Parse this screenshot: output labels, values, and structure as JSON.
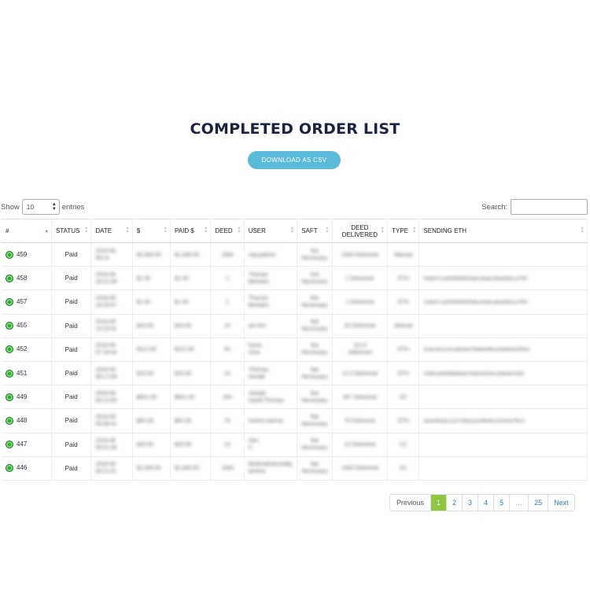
{
  "page": {
    "title": "COMPLETED ORDER LIST",
    "download_label": "DOWNLOAD AS CSV"
  },
  "length_control": {
    "prefix": "Show",
    "value": "10",
    "suffix": "entries"
  },
  "search": {
    "label": "Search:",
    "value": ""
  },
  "table": {
    "headers": [
      "#",
      "STATUS",
      "DATE",
      "$",
      "PAID $",
      "DEED",
      "USER",
      "SAFT",
      "DEED DELIVERED",
      "TYPE",
      "SENDING ETH"
    ],
    "rows": [
      {
        "id": "459",
        "status": "Paid",
        "date": "2018-06 06:14",
        "amount": "$1,000.00",
        "paid": "$1,000.00",
        "deed": "1000",
        "user": "clay.patrick",
        "saft": "Not Necessary",
        "delivered": "1000 Delivered",
        "type": "Manual",
        "eth": ""
      },
      {
        "id": "458",
        "status": "Paid",
        "date": "2018-06 16:21:08",
        "amount": "$1.00",
        "paid": "$1.00",
        "deed": "1",
        "user": "Thomas Bertulen",
        "saft": "Not Necessary",
        "delivered": "1 Delivered",
        "type": "ETH",
        "eth": "0x8b07ca0f459f5900b8cd4a5cd6e8f3b1a7f50"
      },
      {
        "id": "457",
        "status": "Paid",
        "date": "2018-06 16:20:57",
        "amount": "$1.00",
        "paid": "$1.00",
        "deed": "1",
        "user": "Thomas Bertulen",
        "saft": "Not Necessary",
        "delivered": "1 Delivered",
        "type": "ETH",
        "eth": "0x8b07ca0f459f5900b8cd4a5cd6e8f3b1a7f50"
      },
      {
        "id": "455",
        "status": "Paid",
        "date": "2018-06 13:15:01",
        "amount": "$10.00",
        "paid": "$10.00",
        "deed": "10",
        "user": "ian.kim",
        "saft": "Not Necessary",
        "delivered": "20 Delivered",
        "type": "Manual",
        "eth": ""
      },
      {
        "id": "452",
        "status": "Paid",
        "date": "2018-06 07:18:44",
        "amount": "$112.00",
        "paid": "$112.00",
        "deed": "84",
        "user": "Kevin Choi",
        "saft": "Not Necessary",
        "delivered": "112.5 Delivered",
        "type": "ETH",
        "eth": "0xae1bc2c4ca4b3a47bb84ef6ca1bb9e4e3f5ac"
      },
      {
        "id": "451",
        "status": "Paid",
        "date": "2018-06 06:17:09",
        "amount": "$15.00",
        "paid": "$15.00",
        "deed": "15",
        "user": "Thomas Gerald",
        "saft": "Not Necessary",
        "delivered": "12.5 Delivered",
        "type": "ETH",
        "eth": "0x95ca0b4f8fd6a5e7b6e0d1f3c2a9e4b7d28"
      },
      {
        "id": "449",
        "status": "Paid",
        "date": "2018-06 05:12:00",
        "amount": "$801.00",
        "paid": "$801.00",
        "deed": "204",
        "user": "Joseph David Thomas",
        "saft": "Not Necessary",
        "delivered": "467 Delivered",
        "type": "CC",
        "eth": ""
      },
      {
        "id": "448",
        "status": "Paid",
        "date": "2018-06 05:09:41",
        "amount": "$82.00",
        "paid": "$82.00",
        "deed": "70",
        "user": "hoohm.wanna",
        "saft": "Not Necessary",
        "delivered": "70 Delivered",
        "type": "ETH",
        "eth": "0x9d4b3dc12a7c9b0a2e4f6d8c1b3e5a7f9c2"
      },
      {
        "id": "447",
        "status": "Paid",
        "date": "2018-06 05:01:46",
        "amount": "$20.00",
        "paid": "$20.00",
        "deed": "10",
        "user": "Dan C",
        "saft": "Not Necessary",
        "delivered": "12 Delivered",
        "type": "CC",
        "eth": ""
      },
      {
        "id": "446",
        "status": "Paid",
        "date": "2018-06 04:11:01",
        "amount": "$1,000.00",
        "paid": "$1,000.00",
        "deed": "1000",
        "user": "BirdInadvancedby temirar",
        "saft": "Not Necessary",
        "delivered": "1000 Delivered",
        "type": "CC",
        "eth": ""
      }
    ]
  },
  "pagination": {
    "previous": "Previous",
    "pages": [
      "1",
      "2",
      "3",
      "4",
      "5",
      "…",
      "25"
    ],
    "active": "1",
    "next": "Next"
  },
  "colors": {
    "title": "#1c2340",
    "button": "#5bbad9",
    "active_page": "#8dc63f",
    "status_dot": "#2fa82f"
  }
}
